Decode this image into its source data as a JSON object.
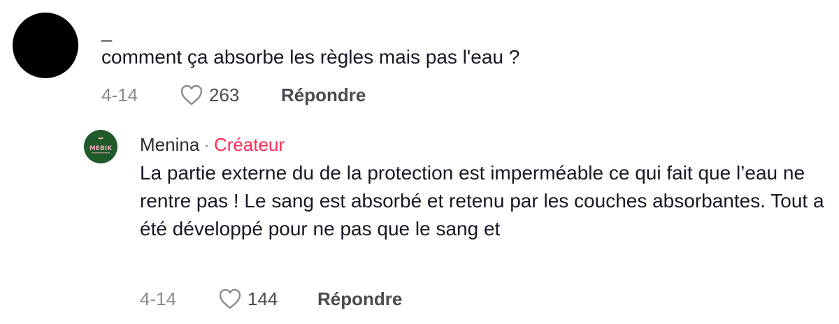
{
  "comments": [
    {
      "username": "_",
      "text": "comment ça absorbe les règles mais pas l'eau ?",
      "date": "4-14",
      "likes": "263",
      "reply_label": "Répondre",
      "avatar_color": "#000000"
    },
    {
      "username": "Menina",
      "separator": "·",
      "badge": "Créateur",
      "text": "La partie externe du de la protection est imperméable ce qui fait que l’eau ne rentre pas ! Le sang est absorbé et retenu par les couches absorbantes. Tout a été développé pour ne pas que le sang et",
      "date": "4-14",
      "likes": "144",
      "reply_label": "Répondre",
      "avatar_logo_text": "MEBIK",
      "avatar_color": "#1f5a2b"
    }
  ],
  "colors": {
    "creator_badge": "#fe2c55",
    "secondary_text": "#8a8b91",
    "primary_text": "#161823"
  },
  "icons": {
    "like": "heart-outline-icon"
  }
}
